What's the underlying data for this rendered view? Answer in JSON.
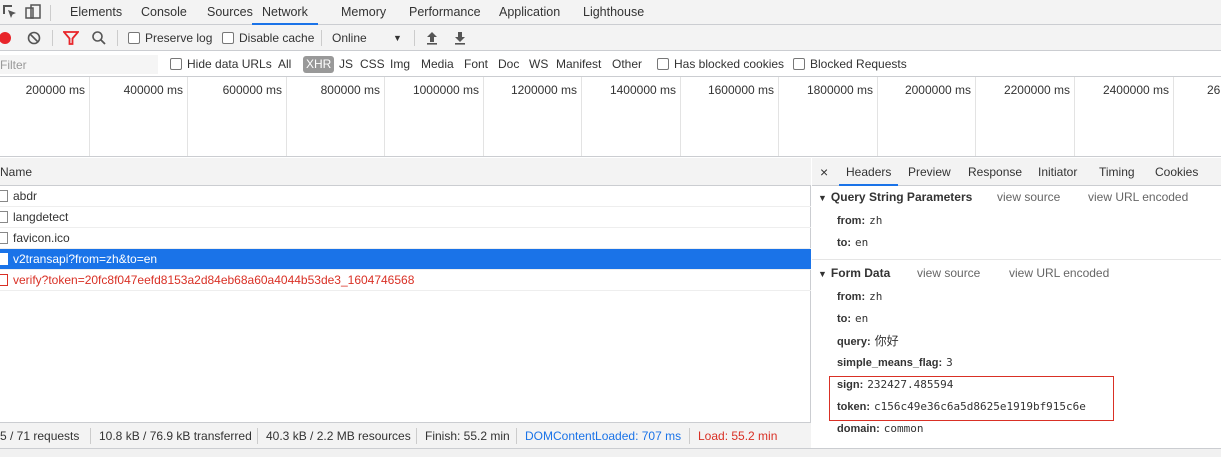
{
  "tabs": [
    {
      "label": "Elements"
    },
    {
      "label": "Console"
    },
    {
      "label": "Sources"
    },
    {
      "label": "Network",
      "active": true
    },
    {
      "label": "Memory"
    },
    {
      "label": "Performance"
    },
    {
      "label": "Application"
    },
    {
      "label": "Lighthouse"
    }
  ],
  "toolbar": {
    "preserve_log": "Preserve log",
    "disable_cache": "Disable cache",
    "throttling": "Online"
  },
  "filterbar": {
    "placeholder": "Filter",
    "hide_data_urls": "Hide data URLs",
    "types": [
      "All",
      "XHR",
      "JS",
      "CSS",
      "Img",
      "Media",
      "Font",
      "Doc",
      "WS",
      "Manifest",
      "Other"
    ],
    "selected_type": "XHR",
    "has_blocked_cookies": "Has blocked cookies",
    "blocked_requests": "Blocked Requests"
  },
  "timeline": {
    "ticks": [
      "200000 ms",
      "400000 ms",
      "600000 ms",
      "800000 ms",
      "1000000 ms",
      "1200000 ms",
      "1400000 ms",
      "1600000 ms",
      "1800000 ms",
      "2000000 ms",
      "2200000 ms",
      "2400000 ms",
      "26"
    ]
  },
  "list": {
    "header": "Name",
    "rows": [
      {
        "name": "abdr",
        "state": "normal"
      },
      {
        "name": "langdetect",
        "state": "normal"
      },
      {
        "name": "favicon.ico",
        "state": "normal"
      },
      {
        "name": "v2transapi?from=zh&to=en",
        "state": "selected"
      },
      {
        "name": "verify?token=20fc8f047eefd8153a2d84eb68a60a4044b53de3_1604746568",
        "state": "error"
      }
    ]
  },
  "status": {
    "requests": "5 / 71 requests",
    "transferred": "10.8 kB / 76.9 kB transferred",
    "resources": "40.3 kB / 2.2 MB resources",
    "finish": "Finish: 55.2 min",
    "dom_content_loaded": "DOMContentLoaded: 707 ms",
    "load": "Load: 55.2 min"
  },
  "details": {
    "close": "×",
    "tabs": [
      "Headers",
      "Preview",
      "Response",
      "Initiator",
      "Timing",
      "Cookies"
    ],
    "active_tab": "Headers",
    "query_section": {
      "title": "Query String Parameters",
      "view_source": "view source",
      "view_url_encoded": "view URL encoded",
      "params": [
        {
          "key": "from:",
          "value": "zh"
        },
        {
          "key": "to:",
          "value": "en"
        }
      ]
    },
    "form_section": {
      "title": "Form Data",
      "view_source": "view source",
      "view_url_encoded": "view URL encoded",
      "params": [
        {
          "key": "from:",
          "value": "zh"
        },
        {
          "key": "to:",
          "value": "en"
        },
        {
          "key": "query:",
          "value": "你好"
        },
        {
          "key": "simple_means_flag:",
          "value": "3"
        },
        {
          "key": "sign:",
          "value": "232427.485594"
        },
        {
          "key": "token:",
          "value": "c156c49e36c6a5d8625e1919bf915c6e"
        },
        {
          "key": "domain:",
          "value": "common"
        }
      ]
    }
  },
  "colors": {
    "accent": "#1a73e8",
    "record": "#e8252a",
    "error": "#d93025"
  }
}
